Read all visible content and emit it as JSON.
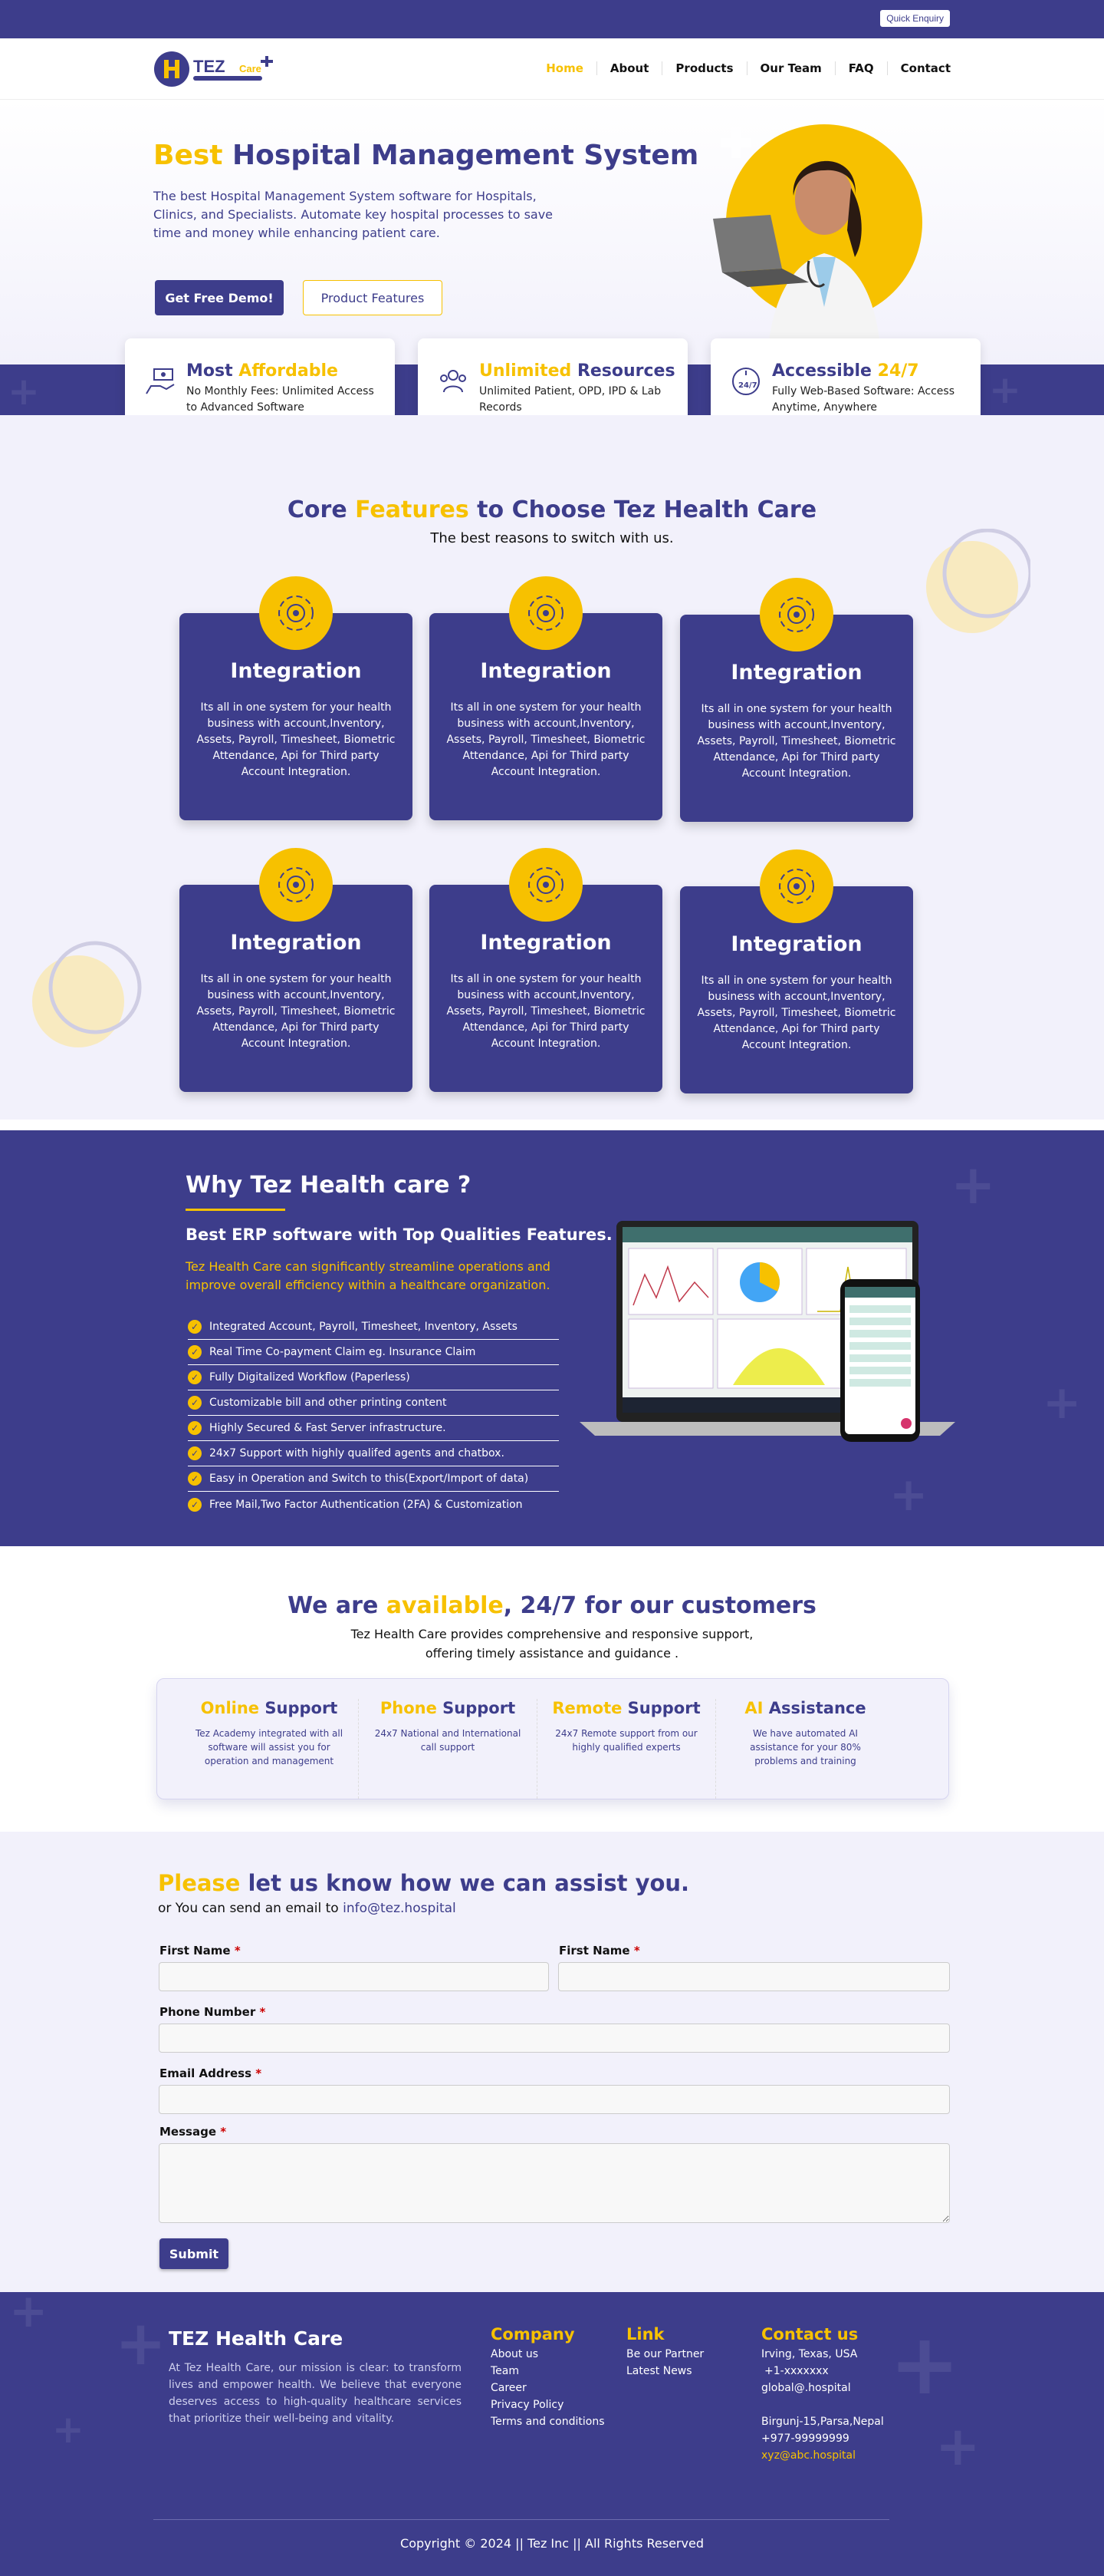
{
  "topbar": {
    "quick_enquiry": "Quick Enquiry"
  },
  "logo": {
    "name": "TEZ",
    "care": "Care"
  },
  "nav": {
    "items": [
      "Home",
      "About",
      "Products",
      "Our Team",
      "FAQ",
      "Contact"
    ],
    "active": "Home"
  },
  "hero": {
    "title_highlight": "Best",
    "title_rest": "Hospital Management System",
    "description": "The best Hospital Management System software for Hospitals, Clinics, and Specialists. Automate key hospital processes to save time and money while enhancing patient care.",
    "demo_button": "Get Free Demo!",
    "features_button": "Product Features"
  },
  "highlights": [
    {
      "title_a": "Most",
      "title_b": "Affordable",
      "desc": "No Monthly Fees: Unlimited Access to Advanced Software",
      "icon": "hand-money-icon"
    },
    {
      "title_a": "Unlimited",
      "title_b": "Resources",
      "desc": "Unlimited Patient, OPD, IPD & Lab Records",
      "icon": "users-icon"
    },
    {
      "title_a": "Accessible",
      "title_b": "24/7",
      "desc": "Fully Web-Based Software: Access Anytime, Anywhere",
      "icon": "clock-24-icon"
    }
  ],
  "core": {
    "title_a": "Core",
    "title_b": "Features",
    "title_c": "to Choose Tez Health Care",
    "subtitle": "The best reasons to switch with us.",
    "cards": [
      {
        "title": "Integration",
        "desc": "Its all in one system for your health business with account,Inventory, Assets, Payroll, Timesheet, Biometric Attendance, Api for Third party Account Integration."
      },
      {
        "title": "Integration",
        "desc": "Its all in one system for your health business with account,Inventory, Assets, Payroll, Timesheet, Biometric Attendance, Api for Third party Account Integration."
      },
      {
        "title": "Integration",
        "desc": "Its all in one system for your health business with account,Inventory, Assets, Payroll, Timesheet, Biometric Attendance, Api for Third party Account Integration."
      },
      {
        "title": "Integration",
        "desc": "Its all in one system for your health business with account,Inventory, Assets, Payroll, Timesheet, Biometric Attendance, Api for Third party Account Integration."
      },
      {
        "title": "Integration",
        "desc": "Its all in one system for your health business with account,Inventory, Assets, Payroll, Timesheet, Biometric Attendance, Api for Third party Account Integration."
      },
      {
        "title": "Integration",
        "desc": "Its all in one system for your health business with account,Inventory, Assets, Payroll, Timesheet, Biometric Attendance, Api for Third party Account Integration."
      }
    ]
  },
  "why": {
    "title": "Why Tez Health care ?",
    "subtitle": "Best ERP software with Top Qualities Features.",
    "lead": "Tez Health Care can significantly streamline operations and improve overall efficiency within a healthcare organization.",
    "items": [
      "Integrated Account, Payroll, Timesheet, Inventory, Assets",
      "Real Time Co-payment Claim eg. Insurance Claim",
      "Fully Digitalized Workflow (Paperless)",
      "Customizable bill and other printing content",
      "Highly Secured & Fast Server infrastructure.",
      "24x7 Support with highly qualifed agents and chatbox.",
      "Easy in Operation and Switch to this(Export/Import of data)",
      "Free Mail,Two Factor Authentication (2FA) & Customization"
    ]
  },
  "available": {
    "title_a": "We are",
    "title_b": "available",
    "title_c": ", 24/7 for our customers",
    "line1": "Tez Health Care provides comprehensive and responsive support,",
    "line2": "offering timely assistance and guidance .",
    "support": [
      {
        "a": "Online",
        "b": "Support",
        "desc": "Tez Academy integrated with all software will assist you for operation and management"
      },
      {
        "a": "Phone",
        "b": "Support",
        "desc": "24x7 National and International call support"
      },
      {
        "a": "Remote",
        "b": "Support",
        "desc": "24x7 Remote support from our highly qualified experts"
      },
      {
        "a": "AI",
        "b": "Assistance",
        "desc": "We have automated AI assistance for your 80% problems and training"
      }
    ]
  },
  "contact": {
    "title_a": "Please",
    "title_b": "let us know how we can assist you.",
    "mail_prefix": "or You can send an email to",
    "mail": "info@tez.hospital",
    "fields": {
      "first_name": "First Name",
      "first_name_2": "First Name",
      "phone": "Phone Number",
      "email": "Email Address",
      "message": "Message"
    },
    "required": "*",
    "submit": "Submit"
  },
  "footer": {
    "title": "TEZ Health Care",
    "desc": "At Tez Health Care, our mission is clear: to transform lives and empower health. We believe that everyone deserves access to high-quality healthcare services that prioritize their well-being and vitality.",
    "company": {
      "title": "Company",
      "links": [
        "About us",
        "Team",
        "Career",
        "Privacy Policy",
        "Terms and conditions"
      ]
    },
    "link": {
      "title": "Link",
      "links": [
        "Be our Partner",
        "Latest News"
      ]
    },
    "contact": {
      "title": "Contact us",
      "addr1": "Irving, Texas, USA",
      "phone1": "+1-xxxxxxx",
      "email1": "global@.hospital",
      "addr2": "Birgunj-15,Parsa,Nepal",
      "phone2": "+977-99999999",
      "email2": "xyz@abc.hospital"
    },
    "copyright": "Copyright © 2024 || Tez Inc || All Rights Reserved"
  },
  "colors": {
    "primary": "#3d3d8b",
    "accent": "#f7c100",
    "light_bg": "#f2f1fb"
  }
}
